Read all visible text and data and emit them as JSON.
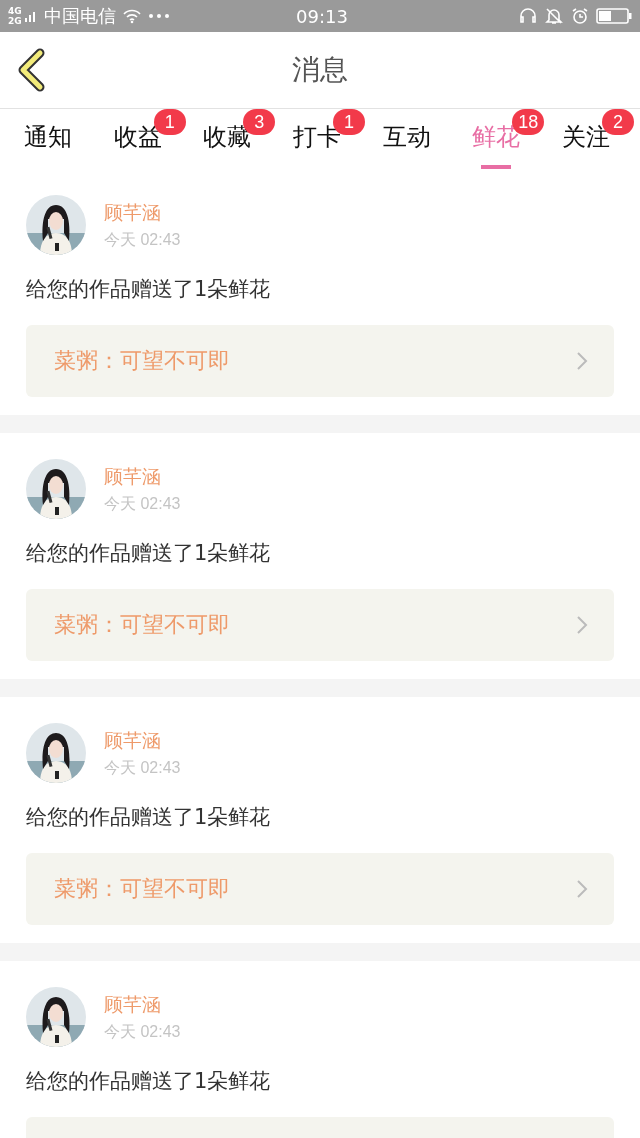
{
  "status_bar": {
    "network": [
      "4G",
      "2G"
    ],
    "carrier": "中国电信",
    "time": "09:13"
  },
  "header": {
    "title": "消息"
  },
  "tabs": [
    {
      "label": "通知",
      "selected": false
    },
    {
      "label": "收益",
      "selected": false,
      "badge": "1"
    },
    {
      "label": "收藏",
      "selected": false,
      "badge": "3"
    },
    {
      "label": "打卡",
      "selected": false,
      "badge": "1"
    },
    {
      "label": "互动",
      "selected": false
    },
    {
      "label": "鲜花",
      "selected": true,
      "badge": "18"
    },
    {
      "label": "关注",
      "selected": false,
      "badge": "2"
    }
  ],
  "messages": [
    {
      "user": "顾芊涵",
      "time": "今天 02:43",
      "text": "给您的作品赠送了1朵鲜花",
      "work": "菜粥：可望不可即"
    },
    {
      "user": "顾芊涵",
      "time": "今天 02:43",
      "text": "给您的作品赠送了1朵鲜花",
      "work": "菜粥：可望不可即"
    },
    {
      "user": "顾芊涵",
      "time": "今天 02:43",
      "text": "给您的作品赠送了1朵鲜花",
      "work": "菜粥：可望不可即"
    },
    {
      "user": "顾芊涵",
      "time": "今天 02:43",
      "text": "给您的作品赠送了1朵鲜花"
    }
  ]
}
